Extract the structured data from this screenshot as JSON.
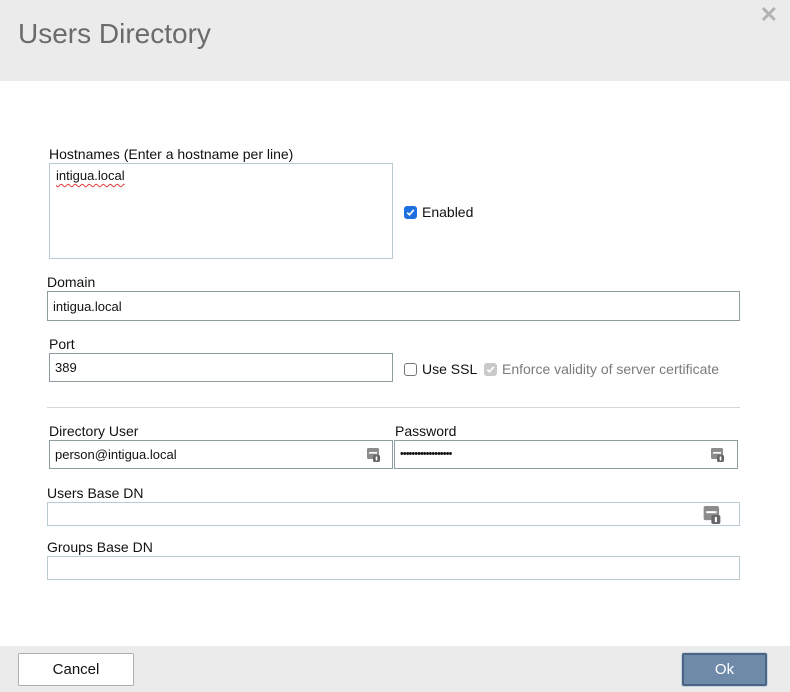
{
  "dialog": {
    "title": "Users Directory",
    "close_icon": "close-icon"
  },
  "hostnames": {
    "label": "Hostnames (Enter a hostname per line)",
    "value": "intigua.local"
  },
  "enabled": {
    "label": "Enabled",
    "checked": true
  },
  "domain": {
    "label": "Domain",
    "value": "intigua.local"
  },
  "port": {
    "label": "Port",
    "value": "389"
  },
  "use_ssl": {
    "label": "Use SSL",
    "checked": false
  },
  "enforce_cert": {
    "label": "Enforce validity of server certificate",
    "checked": true,
    "disabled": true
  },
  "directory_user": {
    "label": "Directory User",
    "value": "person@intigua.local",
    "icon": "password-manager-icon"
  },
  "password": {
    "label": "Password",
    "value": "••••••••••••••••••",
    "icon": "password-manager-icon"
  },
  "users_base_dn": {
    "label": "Users Base DN",
    "value": "",
    "icon": "password-manager-icon"
  },
  "groups_base_dn": {
    "label": "Groups Base DN",
    "value": ""
  },
  "footer": {
    "cancel_label": "Cancel",
    "ok_label": "Ok"
  },
  "colors": {
    "accent": "#1e6fe0",
    "ok_button": "#6f8aa8",
    "header_bg": "#ebebeb"
  }
}
